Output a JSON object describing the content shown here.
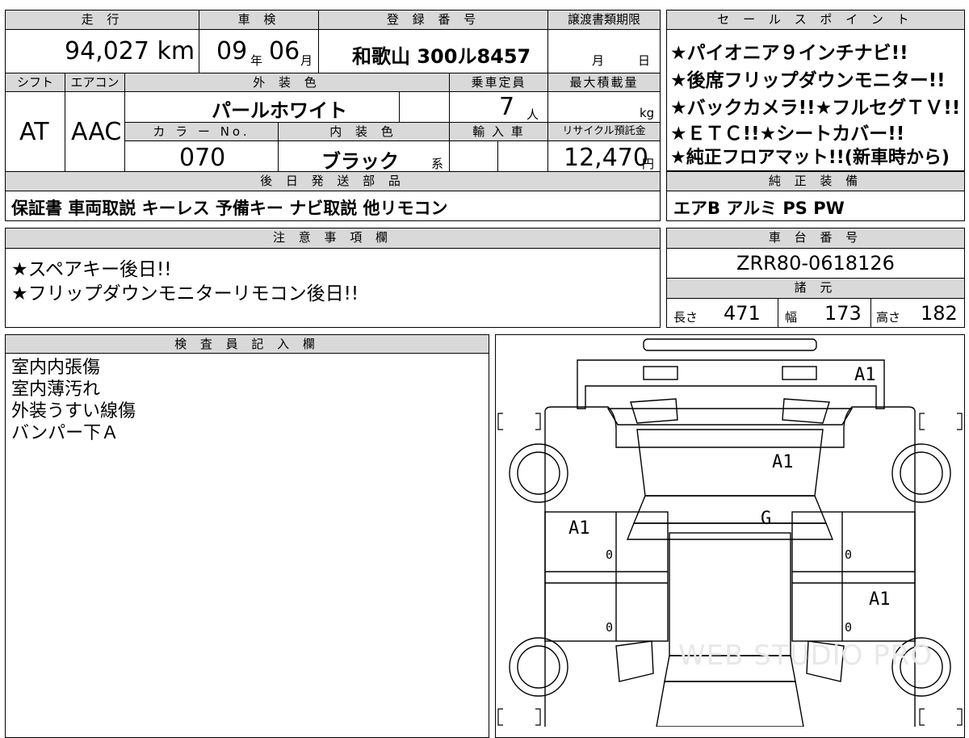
{
  "top": {
    "mileage_label": "走 行",
    "mileage_value": "94,027 km",
    "inspection_label": "車 検",
    "inspection_year": "09",
    "inspection_year_unit": "年",
    "inspection_month": "06",
    "inspection_month_unit": "月",
    "registration_label": "登 録 番 号",
    "registration_value": "和歌山 300ル8457",
    "transfer_label": "譲渡書類期限",
    "transfer_month_unit": "月",
    "transfer_day_unit": "日",
    "shift_label": "シフト",
    "shift_value": "AT",
    "aircon_label": "エアコン",
    "aircon_value": "AAC",
    "exterior_color_label": "外 装 色",
    "exterior_color_value": "パールホワイト",
    "capacity_label": "乗車定員",
    "capacity_value": "7",
    "capacity_unit": "人",
    "max_load_label": "最大積載量",
    "max_load_unit": "kg",
    "color_no_label": "カ ラ ー No.",
    "color_no_value": "070",
    "interior_color_label": "内 装 色",
    "interior_color_value": "ブラック",
    "interior_color_suffix": "系",
    "import_label": "輸 入 車",
    "recycle_label": "リサイクル預託金",
    "recycle_value": "12,470",
    "recycle_unit": "円"
  },
  "later_parts": {
    "label": "後 日 発 送 部 品",
    "value": "保証書 車両取説 キーレス 予備キー ナビ取説 他リモコン"
  },
  "sales_points": {
    "label": "セ ー ル ス ポ イ ン ト",
    "items": [
      "★パイオニア９インチナビ!!",
      "★後席フリップダウンモニター!!",
      "★バックカメラ!!★フルセグＴＶ!!",
      "★ＥＴＣ!!★シートカバー!!",
      "★純正フロアマット!!(新車時から)"
    ]
  },
  "equipment": {
    "label": "純 正 装 備",
    "value": "エアB アルミ PS PW"
  },
  "caution": {
    "label": "注 意 事 項 欄",
    "lines": [
      "★スペアキー後日!!",
      "★フリップダウンモニターリモコン後日!!"
    ]
  },
  "chassis": {
    "label": "車 台 番 号",
    "value": "ZRR80-0618126"
  },
  "specs": {
    "label": "諸 元",
    "length_label": "長さ",
    "length_value": "471",
    "width_label": "幅",
    "width_value": "173",
    "height_label": "高さ",
    "height_value": "182"
  },
  "inspector": {
    "label": "検 査 員 記 入 欄",
    "lines": [
      "室内内張傷",
      "室内薄汚れ",
      "外装うすい線傷",
      "バンパー下Ａ"
    ]
  },
  "diagram": {
    "marks": {
      "rear_top": "A1",
      "roof": "A1",
      "left_front_door": "A1",
      "left_front_door_sub": "0",
      "windshield": "G",
      "right_front_door_sub": "0",
      "right_rear_door": "A1",
      "left_rear_door_sub": "0",
      "right_rear_door_sub": "0"
    },
    "watermark": "WEB STUDIO PRO"
  }
}
